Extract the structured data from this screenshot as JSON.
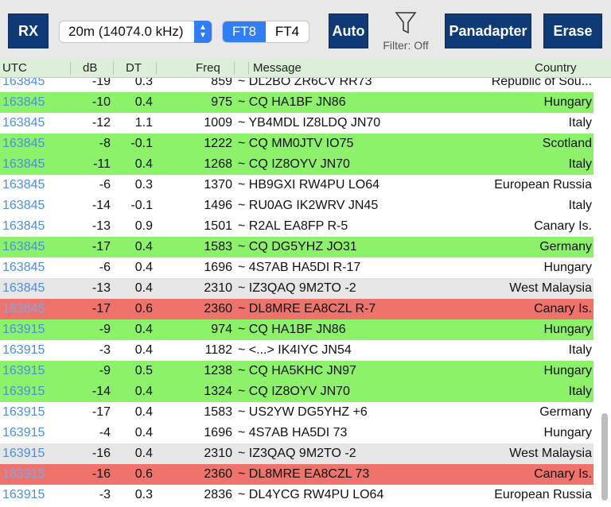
{
  "toolbar": {
    "rx_label": "RX",
    "band_value": "20m (14074.0 kHz)",
    "modes": [
      "FT8",
      "FT4"
    ],
    "auto_label": "Auto",
    "filter_label": "Filter: Off",
    "panadapter_label": "Panadapter",
    "erase_label": "Erase"
  },
  "columns": {
    "utc": "UTC",
    "db": "dB",
    "dt": "DT",
    "freq": "Freq",
    "message": "Message",
    "country": "Country"
  },
  "rows": [
    {
      "utc": "163845",
      "db": "-19",
      "dt": "0.3",
      "freq": "859",
      "msg": "~ DL2BO ZR6CV RR73",
      "country": "Republic of Sou...",
      "bg": "white"
    },
    {
      "utc": "163845",
      "db": "-10",
      "dt": "0.4",
      "freq": "975",
      "msg": "~ CQ HA1BF JN86",
      "country": "Hungary",
      "bg": "green"
    },
    {
      "utc": "163845",
      "db": "-12",
      "dt": "1.1",
      "freq": "1009",
      "msg": "~ YB4MDL IZ8LDQ JN70",
      "country": "Italy",
      "bg": "white"
    },
    {
      "utc": "163845",
      "db": "-8",
      "dt": "-0.1",
      "freq": "1222",
      "msg": "~ CQ MM0JTV IO75",
      "country": "Scotland",
      "bg": "green"
    },
    {
      "utc": "163845",
      "db": "-11",
      "dt": "0.4",
      "freq": "1268",
      "msg": "~ CQ IZ8OYV JN70",
      "country": "Italy",
      "bg": "green"
    },
    {
      "utc": "163845",
      "db": "-6",
      "dt": "0.3",
      "freq": "1370",
      "msg": "~ HB9GXI RW4PU LO64",
      "country": "European Russia",
      "bg": "white"
    },
    {
      "utc": "163845",
      "db": "-14",
      "dt": "-0.1",
      "freq": "1496",
      "msg": "~ RU0AG IK2WRV JN45",
      "country": "Italy",
      "bg": "white"
    },
    {
      "utc": "163845",
      "db": "-13",
      "dt": "0.9",
      "freq": "1501",
      "msg": "~ R2AL EA8FP R-5",
      "country": "Canary Is.",
      "bg": "white"
    },
    {
      "utc": "163845",
      "db": "-17",
      "dt": "0.4",
      "freq": "1583",
      "msg": "~ CQ DG5YHZ JO31",
      "country": "Germany",
      "bg": "green"
    },
    {
      "utc": "163845",
      "db": "-6",
      "dt": "0.4",
      "freq": "1696",
      "msg": "~ 4S7AB HA5DI R-17",
      "country": "Hungary",
      "bg": "white"
    },
    {
      "utc": "163845",
      "db": "-13",
      "dt": "0.4",
      "freq": "2310",
      "msg": "~ IZ3QAQ 9M2TO -2",
      "country": "West Malaysia",
      "bg": "gray"
    },
    {
      "utc": "163845",
      "db": "-17",
      "dt": "0.6",
      "freq": "2360",
      "msg": "~ DL8MRE EA8CZL R-7",
      "country": "Canary Is.",
      "bg": "red"
    },
    {
      "utc": "163915",
      "db": "-9",
      "dt": "0.4",
      "freq": "974",
      "msg": "~ CQ HA1BF JN86",
      "country": "Hungary",
      "bg": "green"
    },
    {
      "utc": "163915",
      "db": "-3",
      "dt": "0.4",
      "freq": "1182",
      "msg": "~ <...> IK4IYC JN54",
      "country": "Italy",
      "bg": "white"
    },
    {
      "utc": "163915",
      "db": "-9",
      "dt": "0.5",
      "freq": "1238",
      "msg": "~ CQ HA5KHC JN97",
      "country": "Hungary",
      "bg": "green"
    },
    {
      "utc": "163915",
      "db": "-14",
      "dt": "0.4",
      "freq": "1324",
      "msg": "~ CQ IZ8OYV JN70",
      "country": "Italy",
      "bg": "green"
    },
    {
      "utc": "163915",
      "db": "-17",
      "dt": "0.4",
      "freq": "1583",
      "msg": "~ US2YW DG5YHZ +6",
      "country": "Germany",
      "bg": "white"
    },
    {
      "utc": "163915",
      "db": "-4",
      "dt": "0.4",
      "freq": "1696",
      "msg": "~ 4S7AB HA5DI 73",
      "country": "Hungary",
      "bg": "white"
    },
    {
      "utc": "163915",
      "db": "-16",
      "dt": "0.4",
      "freq": "2310",
      "msg": "~ IZ3QAQ 9M2TO -2",
      "country": "West Malaysia",
      "bg": "gray"
    },
    {
      "utc": "163915",
      "db": "-16",
      "dt": "0.6",
      "freq": "2360",
      "msg": "~ DL8MRE EA8CZL 73",
      "country": "Canary Is.",
      "bg": "red"
    },
    {
      "utc": "163915",
      "db": "-3",
      "dt": "0.3",
      "freq": "2836",
      "msg": "~ DL4YCG RW4PU LO64",
      "country": "European Russia",
      "bg": "white"
    }
  ]
}
